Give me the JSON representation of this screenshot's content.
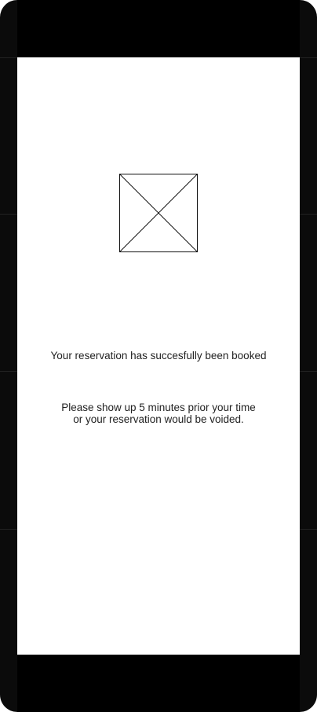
{
  "screen": {
    "image_icon": "image-placeholder-icon",
    "headline": "Your reservation has succesfully been booked",
    "notice_lines": [
      "Please show up 5 minutes prior your time",
      "or your reservation would be voided."
    ]
  },
  "colors": {
    "bezel": "#0b0b0b",
    "bars": "#000000",
    "screen": "#ffffff",
    "text": "#222222"
  }
}
